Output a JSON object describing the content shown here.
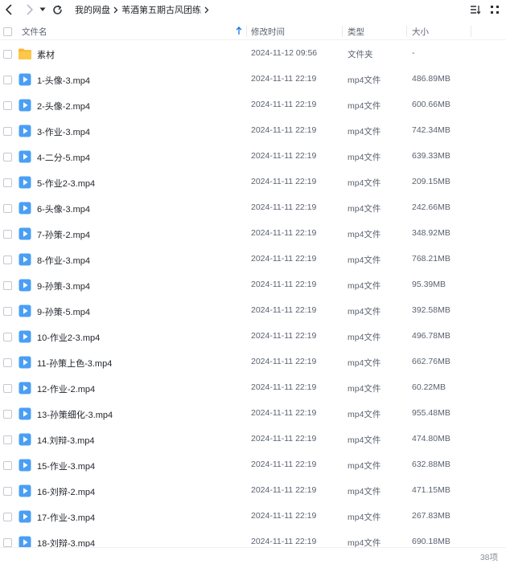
{
  "breadcrumb": [
    "我的网盘",
    "苇酒第五期古风团练"
  ],
  "columns": {
    "name": "文件名",
    "modified": "修改时间",
    "type": "类型",
    "size": "大小"
  },
  "files": [
    {
      "name": "素材",
      "date": "2024-11-12 09:56",
      "type": "文件夹",
      "size": "-",
      "icon": "folder-icon"
    },
    {
      "name": "1-头像-3.mp4",
      "date": "2024-11-11 22:19",
      "type": "mp4文件",
      "size": "486.89MB",
      "icon": "video-file-icon"
    },
    {
      "name": "2-头像-2.mp4",
      "date": "2024-11-11 22:19",
      "type": "mp4文件",
      "size": "600.66MB",
      "icon": "video-file-icon"
    },
    {
      "name": "3-作业-3.mp4",
      "date": "2024-11-11 22:19",
      "type": "mp4文件",
      "size": "742.34MB",
      "icon": "video-file-icon"
    },
    {
      "name": "4-二分-5.mp4",
      "date": "2024-11-11 22:19",
      "type": "mp4文件",
      "size": "639.33MB",
      "icon": "video-file-icon"
    },
    {
      "name": "5-作业2-3.mp4",
      "date": "2024-11-11 22:19",
      "type": "mp4文件",
      "size": "209.15MB",
      "icon": "video-file-icon"
    },
    {
      "name": "6-头像-3.mp4",
      "date": "2024-11-11 22:19",
      "type": "mp4文件",
      "size": "242.66MB",
      "icon": "video-file-icon"
    },
    {
      "name": "7-孙策-2.mp4",
      "date": "2024-11-11 22:19",
      "type": "mp4文件",
      "size": "348.92MB",
      "icon": "video-file-icon"
    },
    {
      "name": "8-作业-3.mp4",
      "date": "2024-11-11 22:19",
      "type": "mp4文件",
      "size": "768.21MB",
      "icon": "video-file-icon"
    },
    {
      "name": "9-孙策-3.mp4",
      "date": "2024-11-11 22:19",
      "type": "mp4文件",
      "size": "95.39MB",
      "icon": "video-file-icon"
    },
    {
      "name": "9-孙策-5.mp4",
      "date": "2024-11-11 22:19",
      "type": "mp4文件",
      "size": "392.58MB",
      "icon": "video-file-icon"
    },
    {
      "name": "10-作业2-3.mp4",
      "date": "2024-11-11 22:19",
      "type": "mp4文件",
      "size": "496.78MB",
      "icon": "video-file-icon"
    },
    {
      "name": "11-孙策上色-3.mp4",
      "date": "2024-11-11 22:19",
      "type": "mp4文件",
      "size": "662.76MB",
      "icon": "video-file-icon"
    },
    {
      "name": "12-作业-2.mp4",
      "date": "2024-11-11 22:19",
      "type": "mp4文件",
      "size": "60.22MB",
      "icon": "video-file-icon"
    },
    {
      "name": "13-孙策细化-3.mp4",
      "date": "2024-11-11 22:19",
      "type": "mp4文件",
      "size": "955.48MB",
      "icon": "video-file-icon"
    },
    {
      "name": "14.刘辩-3.mp4",
      "date": "2024-11-11 22:19",
      "type": "mp4文件",
      "size": "474.80MB",
      "icon": "video-file-icon"
    },
    {
      "name": "15-作业-3.mp4",
      "date": "2024-11-11 22:19",
      "type": "mp4文件",
      "size": "632.88MB",
      "icon": "video-file-icon"
    },
    {
      "name": "16-刘辩-2.mp4",
      "date": "2024-11-11 22:19",
      "type": "mp4文件",
      "size": "471.15MB",
      "icon": "video-file-icon"
    },
    {
      "name": "17-作业-3.mp4",
      "date": "2024-11-11 22:19",
      "type": "mp4文件",
      "size": "267.83MB",
      "icon": "video-file-icon"
    },
    {
      "name": "18-刘辩-3.mp4",
      "date": "2024-11-11 22:19",
      "type": "mp4文件",
      "size": "690.18MB",
      "icon": "video-file-icon"
    }
  ],
  "footer": {
    "count": "38项"
  },
  "colors": {
    "accent": "#1a73e8",
    "folder": "#f7b733",
    "video": "#4a9ff5"
  }
}
